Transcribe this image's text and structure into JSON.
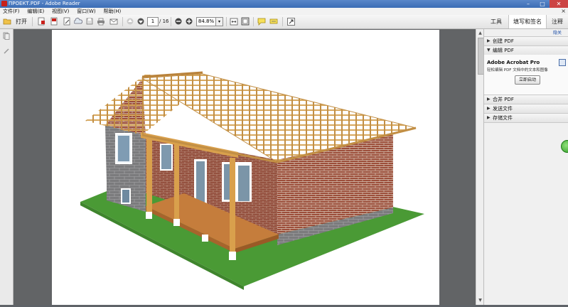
{
  "window": {
    "title": "ПРОЕКТ.PDF - Adobe Reader",
    "controls": {
      "minimize": "–",
      "maximize": "□",
      "close": "✕"
    }
  },
  "menu": {
    "items": [
      "文件(F)",
      "编辑(E)",
      "视图(V)",
      "窗口(W)",
      "帮助(H)"
    ],
    "close_glyph": "×"
  },
  "toolbar": {
    "open_label": "打开",
    "page_current": "1",
    "page_total": "/ 16",
    "zoom": "84.8%",
    "zoom_dropdown": "▾"
  },
  "right_tabs": {
    "tools": "工具",
    "sign": "填写和签名",
    "comment": "注释"
  },
  "panel": {
    "hide_label": "隐关",
    "sections": {
      "create_pdf": {
        "arrow": "▶",
        "label": "创建 PDF"
      },
      "edit_pdf": {
        "arrow": "▼",
        "label": "编辑 PDF"
      },
      "combine_pdf": {
        "arrow": "▶",
        "label": "合并 PDF"
      },
      "send_files": {
        "arrow": "▶",
        "label": "发送文件"
      },
      "store_files": {
        "arrow": "▶",
        "label": "存储文件"
      }
    },
    "promo": {
      "title": "Adobe Acrobat Pro",
      "description": "轻松编辑 PDF 文档中的文本和图像",
      "button": "立即启动"
    }
  },
  "icons": {
    "open": "folder-open-icon",
    "print": "printer-icon",
    "email": "email-icon",
    "prev": "arrow-up-icon",
    "next": "arrow-down-icon",
    "zoom_out": "minus-icon",
    "zoom_in": "plus-icon",
    "comment": "speech-bubble-icon",
    "highlight": "highlighter-icon",
    "fullscreen": "expand-icon"
  },
  "colors": {
    "title_bar": "#3b6db5",
    "link": "#1f50a8",
    "app_icon": "#c8201a",
    "action_green": "#2f9c25"
  }
}
